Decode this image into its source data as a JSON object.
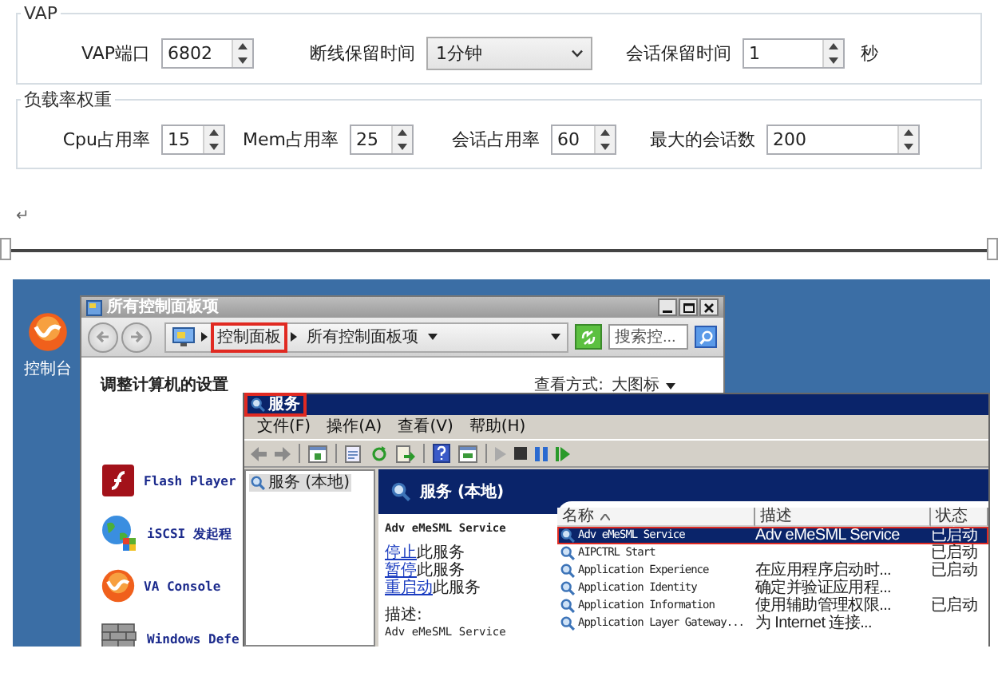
{
  "settings_form": {
    "groups": [
      {
        "title": "VAP",
        "fields": [
          {
            "kind": "spin",
            "label": "VAP端口",
            "value": "6802"
          },
          {
            "kind": "combo",
            "label": "断线保留时间",
            "value": "1分钟"
          },
          {
            "kind": "spin",
            "label": "会话保留时间",
            "value": "1",
            "unit": "秒"
          }
        ]
      },
      {
        "title": "负载率权重",
        "fields": [
          {
            "kind": "spin",
            "label": "Cpu占用率",
            "value": "15"
          },
          {
            "kind": "spin",
            "label": "Mem占用率",
            "value": "25"
          },
          {
            "kind": "spin",
            "label": "会话占用率",
            "value": "60"
          },
          {
            "kind": "spin",
            "label": "最大的会话数",
            "value": "200"
          }
        ]
      }
    ]
  },
  "paragraph_mark": "↵",
  "screenshot": {
    "desktop_icons": [
      {
        "label": "控制台"
      }
    ],
    "control_panel": {
      "title": "所有控制面板项",
      "breadcrumb": [
        {
          "label": "控制面板",
          "highlighted": true
        },
        {
          "label": "所有控制面板项",
          "highlighted": false
        }
      ],
      "search_placeholder": "搜索控...",
      "heading": "调整计算机的设置",
      "view_by_label": "查看方式:",
      "view_by_value": "大图标",
      "items": [
        {
          "kind": "flash",
          "label": "Flash Player"
        },
        {
          "kind": "globe",
          "label": "iSCSI 发起程"
        },
        {
          "kind": "va",
          "label": "VA Console"
        },
        {
          "kind": "wall",
          "label": "Windows Defe"
        }
      ]
    },
    "services": {
      "title": "服务",
      "title_highlighted": true,
      "menu": [
        "文件(F)",
        "操作(A)",
        "查看(V)",
        "帮助(H)"
      ],
      "tree": [
        {
          "label": "服务 (本地)",
          "selected": true
        }
      ],
      "pane_title": "服务 (本地)",
      "service_name": "Adv eMeSML Service",
      "actions": [
        {
          "link": "停止",
          "text": "此服务"
        },
        {
          "link": "暂停",
          "text": "此服务"
        },
        {
          "link": "重启动",
          "text": "此服务"
        }
      ],
      "description_label": "描述:",
      "description": "Adv eMeSML Service",
      "columns": [
        {
          "label": "名称",
          "sorted": true
        },
        {
          "label": "描述",
          "sorted": false
        },
        {
          "label": "状态",
          "sorted": false
        }
      ],
      "rows": [
        {
          "name": "Adv eMeSML Service",
          "description": "Adv eMeSML Service",
          "status": "已启动",
          "selected": true,
          "highlighted": true
        },
        {
          "name": "AIPCTRL Start",
          "status": "已启动",
          "selected": false,
          "highlighted": false
        },
        {
          "name": "Application Experience",
          "description": "在应用程序启动时...",
          "status": "已启动",
          "selected": false,
          "highlighted": false
        },
        {
          "name": "Application Identity",
          "description": "确定并验证应用程...",
          "selected": false,
          "highlighted": false
        },
        {
          "name": "Application Information",
          "description": "使用辅助管理权限...",
          "status": "已启动",
          "selected": false,
          "highlighted": false
        },
        {
          "name": "Application Layer Gateway...",
          "description": "为 Internet 连接...",
          "selected": false,
          "highlighted": false
        }
      ]
    }
  }
}
